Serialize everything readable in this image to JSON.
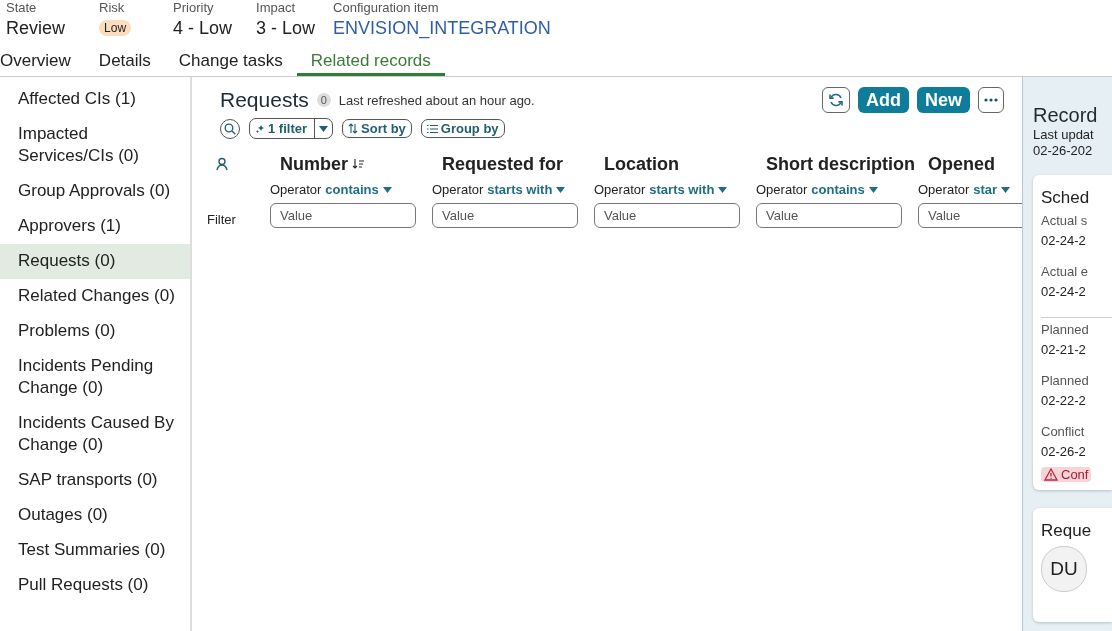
{
  "header_fields": [
    {
      "label": "State",
      "value": "Review",
      "kind": "text"
    },
    {
      "label": "Risk",
      "value": "Low",
      "kind": "badge"
    },
    {
      "label": "Priority",
      "value": "4 - Low",
      "kind": "text"
    },
    {
      "label": "Impact",
      "value": "3 - Low",
      "kind": "text"
    },
    {
      "label": "Configuration item",
      "value": "ENVISION_INTEGRATION",
      "kind": "link"
    }
  ],
  "tabs": [
    {
      "label": "Overview",
      "selected": false
    },
    {
      "label": "Details",
      "selected": false
    },
    {
      "label": "Change tasks",
      "selected": false
    },
    {
      "label": "Related records",
      "selected": true
    }
  ],
  "sidebar": {
    "items": [
      {
        "label": "Affected CIs (1)",
        "selected": false
      },
      {
        "label": "Impacted Services/CIs (0)",
        "selected": false
      },
      {
        "label": "Group Approvals (0)",
        "selected": false
      },
      {
        "label": "Approvers (1)",
        "selected": false
      },
      {
        "label": "Requests (0)",
        "selected": true
      },
      {
        "label": "Related Changes (0)",
        "selected": false
      },
      {
        "label": "Problems (0)",
        "selected": false
      },
      {
        "label": "Incidents Pending Change (0)",
        "selected": false
      },
      {
        "label": "Incidents Caused By Change (0)",
        "selected": false
      },
      {
        "label": "SAP transports (0)",
        "selected": false
      },
      {
        "label": "Outages (0)",
        "selected": false
      },
      {
        "label": "Test Summaries (0)",
        "selected": false
      },
      {
        "label": "Pull Requests (0)",
        "selected": false
      }
    ]
  },
  "list": {
    "title": "Requests",
    "count": "0",
    "refreshed": "Last refreshed about an hour ago.",
    "filter_button": "1 filter",
    "sort_button": "Sort by",
    "group_button": "Group by",
    "actions": [
      "Add",
      "New"
    ],
    "filter_label": "Filter",
    "columns": [
      {
        "label": "Number",
        "sorted": true,
        "operator_label": "Operator",
        "operator": "contains",
        "placeholder": "Value"
      },
      {
        "label": "Requested for",
        "sorted": false,
        "operator_label": "Operator",
        "operator": "starts with",
        "placeholder": "Value"
      },
      {
        "label": "Location",
        "sorted": false,
        "operator_label": "Operator",
        "operator": "starts with",
        "placeholder": "Value"
      },
      {
        "label": "Short description",
        "sorted": false,
        "operator_label": "Operator",
        "operator": "contains",
        "placeholder": "Value"
      },
      {
        "label": "Opened",
        "sorted": false,
        "operator_label": "Operator",
        "operator": "star",
        "placeholder": "Value"
      }
    ]
  },
  "side_panel": {
    "title": "Record",
    "subtitle": [
      "Last updat",
      "02-26-202"
    ],
    "schedule_card": {
      "title": "Sched",
      "fields": [
        {
          "label": "Actual s",
          "value": "02-24-2",
          "divider_after": false
        },
        {
          "label": "Actual e",
          "value": "02-24-2",
          "divider_after": true
        },
        {
          "label": "Planned",
          "value": "02-21-2",
          "divider_after": false
        },
        {
          "label": "Planned",
          "value": "02-22-2",
          "divider_after": false
        },
        {
          "label": "Conflict",
          "value": "02-26-2",
          "divider_after": false
        }
      ],
      "alert": "Conf"
    },
    "requester_card": {
      "title": "Reque",
      "avatar": "DU"
    }
  }
}
